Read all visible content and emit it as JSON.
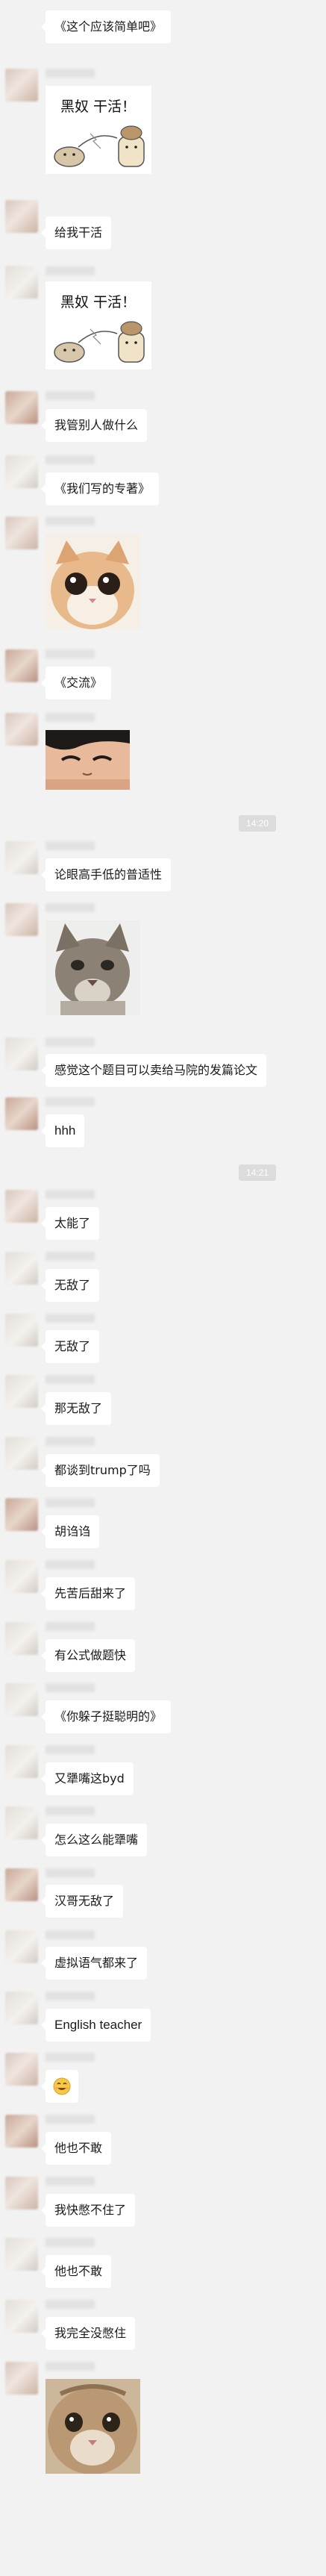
{
  "messages": [
    {
      "type": "text",
      "text": "《这个应该简单吧》"
    },
    {
      "type": "sticker",
      "caption": "黑奴 干活！",
      "subject": "hamster pulling cart"
    },
    {
      "type": "text",
      "text": "给我干活"
    },
    {
      "type": "sticker",
      "caption": "黑奴 干活！",
      "subject": "hamster pulling cart"
    },
    {
      "type": "text",
      "text": "我管别人做什么"
    },
    {
      "type": "text",
      "text": "《我们写的专著》"
    },
    {
      "type": "sticker",
      "subject": "staring cat"
    },
    {
      "type": "text",
      "text": "《交流》"
    },
    {
      "type": "sticker",
      "subject": "cartoon face"
    },
    {
      "type": "timestamp",
      "text": "14:20"
    },
    {
      "type": "text",
      "text": "论眼高手低的普适性"
    },
    {
      "type": "sticker",
      "subject": "gray cat"
    },
    {
      "type": "text",
      "text": "感觉这个题目可以卖给马院的发篇论文"
    },
    {
      "type": "text",
      "text": "hhh"
    },
    {
      "type": "timestamp",
      "text": "14:21"
    },
    {
      "type": "text",
      "text": "太能了"
    },
    {
      "type": "text",
      "text": "无敌了"
    },
    {
      "type": "text",
      "text": "无敌了"
    },
    {
      "type": "text",
      "text": "那无敌了"
    },
    {
      "type": "text",
      "text": "都谈到trump了吗"
    },
    {
      "type": "text",
      "text": "胡诌诌"
    },
    {
      "type": "text",
      "text": "先苦后甜来了"
    },
    {
      "type": "text",
      "text": "有公式做题快"
    },
    {
      "type": "text",
      "text": "《你躲子挺聪明的》"
    },
    {
      "type": "text",
      "text": "又犟嘴这byd"
    },
    {
      "type": "text",
      "text": "怎么这么能犟嘴"
    },
    {
      "type": "text",
      "text": "汉哥无敌了"
    },
    {
      "type": "text",
      "text": "虚拟语气都来了"
    },
    {
      "type": "text",
      "text": "English teacher"
    },
    {
      "type": "emoji",
      "subject": "smiling-emoji"
    },
    {
      "type": "text",
      "text": "他也不敢"
    },
    {
      "type": "text",
      "text": "我快憋不住了"
    },
    {
      "type": "text",
      "text": "他也不敢"
    },
    {
      "type": "text",
      "text": "我完全没憋住"
    },
    {
      "type": "sticker",
      "subject": "close-up cat"
    }
  ],
  "colors": {
    "background": "#f2f2f2",
    "bubble": "#ffffff",
    "timestamp_bg": "#dcdcdc",
    "text": "#1a1a1a"
  }
}
